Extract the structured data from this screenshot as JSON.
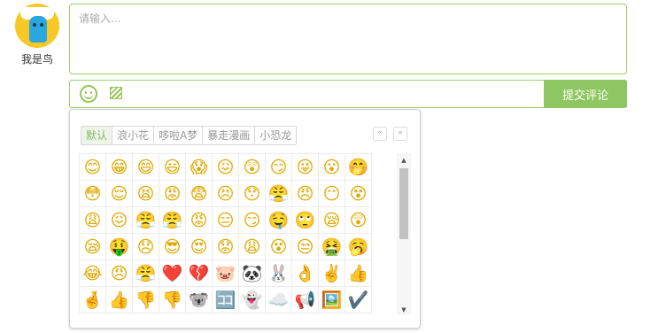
{
  "user": {
    "name": "我是鸟"
  },
  "comment": {
    "placeholder": "请输入..."
  },
  "toolbar": {
    "emoji_icon": "smile-icon",
    "image_icon": "image-icon",
    "submit_label": "提交评论"
  },
  "emoji_panel": {
    "tabs": [
      "默认",
      "浪小花",
      "哆啦A梦",
      "暴走漫画",
      "小恐龙"
    ],
    "active_tab": 0,
    "prev_page": "«",
    "next_page": "»",
    "scroll_up": "▲",
    "scroll_down": "▼",
    "emojis": [
      "😊",
      "😁",
      "😄",
      "😃",
      "😱",
      "😖",
      "😲",
      "😏",
      "😜",
      "😮",
      "🤭",
      "😳",
      "😌",
      "😫",
      "😡",
      "😨",
      "😣",
      "😯",
      "😤",
      "😠",
      "😶",
      "😵",
      "😩",
      "😖",
      "😤",
      "😤",
      "😡",
      "😑",
      "😏",
      "🤤",
      "🙄",
      "😪",
      "😲",
      "😪",
      "🤑",
      "😞",
      "😎",
      "😍",
      "😟",
      "😩",
      "😵",
      "😒",
      "🤮",
      "🥱",
      "😂",
      "😠",
      "😤",
      "❤️",
      "💔",
      "🐷",
      "🐼",
      "🐰",
      "👌",
      "✌️",
      "👍",
      "🤞",
      "👍",
      "👎",
      "👎",
      "🐨",
      "🈁",
      "👻",
      "☁️",
      "📢",
      "🖼️",
      "✔️"
    ]
  }
}
